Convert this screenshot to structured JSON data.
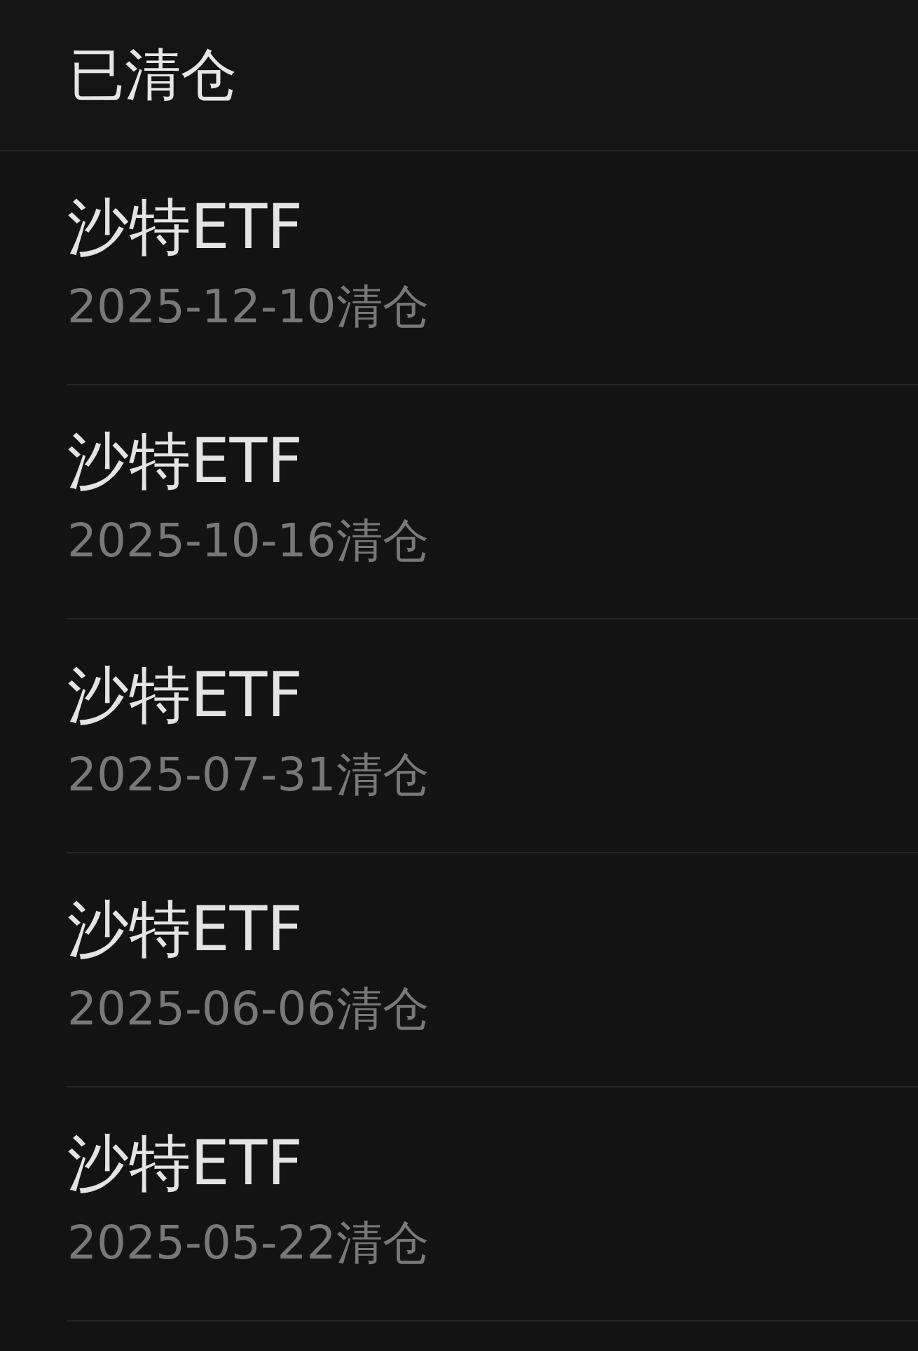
{
  "header": {
    "title": "已清仓"
  },
  "positions": [
    {
      "name": "沙特ETF",
      "cleared": "2025-12-10清仓"
    },
    {
      "name": "沙特ETF",
      "cleared": "2025-10-16清仓"
    },
    {
      "name": "沙特ETF",
      "cleared": "2025-07-31清仓"
    },
    {
      "name": "沙特ETF",
      "cleared": "2025-06-06清仓"
    },
    {
      "name": "沙特ETF",
      "cleared": "2025-05-22清仓"
    }
  ]
}
